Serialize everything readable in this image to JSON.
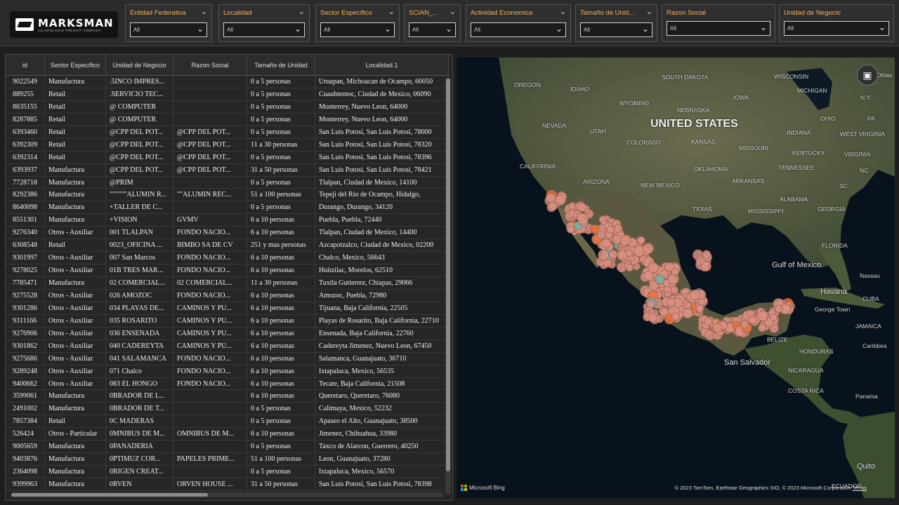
{
  "brand": {
    "name": "MARKSMAN",
    "tagline": "AN INTELOGIX FREIGHT COMPANY"
  },
  "slicers": [
    {
      "title": "Entidad Federativa",
      "value": "All"
    },
    {
      "title": "Localidad",
      "value": "All"
    },
    {
      "title": "Sector Específico",
      "value": "All"
    },
    {
      "title": "SCIAN_...",
      "value": "All"
    },
    {
      "title": "Actividad Economica",
      "value": "All"
    },
    {
      "title": "Tamaño de Unid...",
      "value": "All"
    },
    {
      "title": "Razon Social",
      "value": "All"
    },
    {
      "title": "Unidad de Negocio",
      "value": "All"
    }
  ],
  "table": {
    "columns": [
      "id",
      "Sector Específico",
      "Unidad de Negocio",
      "Razon Social",
      "Tamaño de Unidad",
      "Localidad.1"
    ],
    "rows": [
      [
        "9022549",
        "Manufactura",
        ".5INCO IMPRES...",
        "",
        "0 a 5 personas",
        "Uruapan, Michoacan de Ocampo, 60050"
      ],
      [
        "889255",
        "Retail",
        ".SERVICIO TEC...",
        "",
        "0 a 5 personas",
        "Cuauhtemoc, Ciudad de Mexico, 06090"
      ],
      [
        "8635155",
        "Retail",
        "@ COMPUTER",
        "",
        "0 a 5 personas",
        "Monterrey, Nuevo Leon, 64000"
      ],
      [
        "8287885",
        "Retail",
        "@ COMPUTER",
        "",
        "0 a 5 personas",
        "Monterrey, Nuevo Leon, 64000"
      ],
      [
        "6393460",
        "Retail",
        "@CPP DEL POT...",
        "@CPP DEL POT...",
        "0 a 5 personas",
        "San Luis Potosi, San Luis Potosi, 78000"
      ],
      [
        "6392309",
        "Retail",
        "@CPP DEL POT...",
        "@CPP DEL POT...",
        "11 a 30 personas",
        "San Luis Potosi, San Luis Potosi, 78320"
      ],
      [
        "6392314",
        "Retail",
        "@CPP DEL POT...",
        "@CPP DEL POT...",
        "0 a 5 personas",
        "San Luis Potosi, San Luis Potosi, 78396"
      ],
      [
        "6393937",
        "Manufactura",
        "@CPP DEL POT...",
        "@CPP DEL POT...",
        "31 a 50 personas",
        "San Luis Potosi, San Luis Potosi, 78421"
      ],
      [
        "7728718",
        "Manufactura",
        "@PRIM",
        "",
        "0 a 5 personas",
        "Tlalpan, Ciudad de Mexico, 14100"
      ],
      [
        "8292386",
        "Manufactura",
        "\"\"\"\"\"\"ALUMIN R...",
        "\"\"ALUMIN REC...",
        "51 a 100 personas",
        "Tepeji del Rio de Ocampo, Hidalgo,"
      ],
      [
        "8640098",
        "Manufactura",
        "+TALLER DE C...",
        "",
        "0 a 5 personas",
        "Durango, Durango, 34120"
      ],
      [
        "8551301",
        "Manufactura",
        "+VISION",
        "GVMV",
        "6 a 10 personas",
        "Puebla, Puebla, 72440"
      ],
      [
        "9276340",
        "Otros - Auxiliar",
        "001 TLALPAN",
        "FONDO NACIO...",
        "6 a 10 personas",
        "Tlalpan, Ciudad de Mexico, 14400"
      ],
      [
        "6308548",
        "Retail",
        "0023_OFICINA ...",
        "BIMBO SA DE CV",
        "251 y mas personas",
        "Azcapotzalco, Ciudad de Mexico, 02200"
      ],
      [
        "9301997",
        "Otros - Auxiliar",
        "007 San Marcos",
        "FONDO NACIO...",
        "6 a 10 personas",
        "Chalco, Mexico, 56643"
      ],
      [
        "9278025",
        "Otros - Auxiliar",
        "01B TRES MAR...",
        "FONDO NACIO...",
        "6 a 10 personas",
        "Huitzilac, Morelos, 62510"
      ],
      [
        "7785471",
        "Manufactura",
        "02 COMERCIAL...",
        "02 COMERCIAL...",
        "11 a 30 personas",
        "Tuxtla Gutierrez, Chiapas, 29066"
      ],
      [
        "9275528",
        "Otros - Auxiliar",
        "026 AMOZOC",
        "FONDO NACIO...",
        "6 a 10 personas",
        "Amozoc, Puebla, 72980"
      ],
      [
        "9301286",
        "Otros - Auxiliar",
        "034 PLAYAS DE...",
        "CAMINOS Y PU...",
        "6 a 10 personas",
        "Tijuana, Baja California, 22505"
      ],
      [
        "9311166",
        "Otros - Auxiliar",
        "035 ROSARITO",
        "CAMINOS Y PU...",
        "6 a 10 personas",
        "Playas de Rosarito, Baja California, 22710"
      ],
      [
        "9276906",
        "Otros - Auxiliar",
        "036 ENSENADA",
        "CAMINOS Y PU...",
        "6 a 10 personas",
        "Ensenada, Baja California, 22760"
      ],
      [
        "9301862",
        "Otros - Auxiliar",
        "040 CADEREYTA",
        "CAMINOS Y PU...",
        "6 a 10 personas",
        "Cadereyta Jimenez, Nuevo Leon, 67450"
      ],
      [
        "9275686",
        "Otros - Auxiliar",
        "041 SALAMANCA",
        "FONDO NACIO...",
        "6 a 10 personas",
        "Salamanca, Guanajuato, 36710"
      ],
      [
        "9289248",
        "Otros - Auxiliar",
        "071 Chalco",
        "FONDO NACIO...",
        "6 a 10 personas",
        "Ixtapaluca, Mexico, 56535"
      ],
      [
        "9400662",
        "Otros - Auxiliar",
        "083 EL HONGO",
        "FONDO NACIO...",
        "6 a 10 personas",
        "Tecate, Baja California, 21508"
      ],
      [
        "3599061",
        "Manufactura",
        "0BRADOR DE L...",
        "",
        "6 a 10 personas",
        "Queretaro, Queretaro, 76080"
      ],
      [
        "2491002",
        "Manufactura",
        "0BRADOR DE T...",
        "",
        "0 a 5 personas",
        "Calimaya, Mexico, 52232"
      ],
      [
        "7857384",
        "Retail",
        "0C MADERAS",
        "",
        "0 a 5 personas",
        "Apaseo el Alto, Guanajuato, 38500"
      ],
      [
        "526424",
        "Otros - Particular",
        "0MNIBUS DE M...",
        "OMNIBUS DE M...",
        "6 a 10 personas",
        "Jimenez, Chihuahua, 33980"
      ],
      [
        "9005659",
        "Manufactura",
        "0PANADERIA",
        "",
        "0 a 5 personas",
        "Taxco de Alarcon, Guerrero, 40250"
      ],
      [
        "9403876",
        "Manufactura",
        "0PTIMUZ COR...",
        "PAPELES PRIME...",
        "51 a 100 personas",
        "Leon, Guanajuato, 37280"
      ],
      [
        "2364098",
        "Manufactura",
        "0RIGEN CREAT...",
        "",
        "0 a 5 personas",
        "Ixtapaluca, Mexico, 56570"
      ],
      [
        "9399963",
        "Manufactura",
        "0RVEN",
        "ORVEN HOUSE ...",
        "31 a 50 personas",
        "San Luis Potosi, San Luis Potosi, 78398"
      ]
    ]
  },
  "map": {
    "labels": {
      "us": "UNITED STATES",
      "gulf": "Gulf of Mexico",
      "havana": "Havana",
      "cuba": "CUBA",
      "george_town": "George Town",
      "jamaica": "JAMAICA",
      "belize": "BELIZE",
      "honduras": "HONDURAS",
      "san_salvador": "San Salvador",
      "nicaragua": "NICARAGUA",
      "costa_rica": "COSTA RICA",
      "panama": "Panama",
      "quito": "Quito",
      "ecuador": "ECUADOR",
      "caribbean": "Caribbea",
      "nassau": "Nassau",
      "oregon": "OREGON",
      "idaho": "IDAHO",
      "nevada": "NEVADA",
      "utah": "UTAH",
      "california": "CALIFORNIA",
      "arizona": "ARIZONA",
      "colorado": "COLORADO",
      "new_mexico": "NEW MEXICO",
      "wyoming": "WYOMING",
      "south_dakota": "SOUTH DAKOTA",
      "nebraska": "NEBRASKA",
      "kansas": "KANSAS",
      "oklahoma": "OKLAHOMA",
      "texas": "TEXAS",
      "iowa": "IOWA",
      "missouri": "MISSOURI",
      "arkansas": "ARKANSAS",
      "mississippi": "MISSISSIPPI",
      "alabama": "ALABAMA",
      "georgia": "GEORGIA",
      "florida": "FLORIDA",
      "tennessee": "TENNESSEE",
      "kentucky": "KENTUCKY",
      "indiana": "INDIANA",
      "ohio": "OHIO",
      "wisconsin": "WISCONSIN",
      "michigan": "MICHIGAN",
      "west_virginia": "WEST VIRGINIA",
      "virginia": "VIRGINIA",
      "nc": "NC",
      "sc": "SC",
      "ny": "N.Y.",
      "pa": "PA",
      "ottawa": "Ottaw"
    },
    "attribution_left": "Microsoft Bing",
    "attribution_right": "© 2023 TomTom, Earthstar Geographics SIO, © 2023 Microsoft Corporation",
    "terms": "Terms",
    "focus_icon": "focus-mode-icon"
  },
  "colors": {
    "accent": "#f2b05a",
    "marker": "#d98f80",
    "marker_hot": "#e8723a",
    "marker_teal": "#6fb2a8"
  }
}
